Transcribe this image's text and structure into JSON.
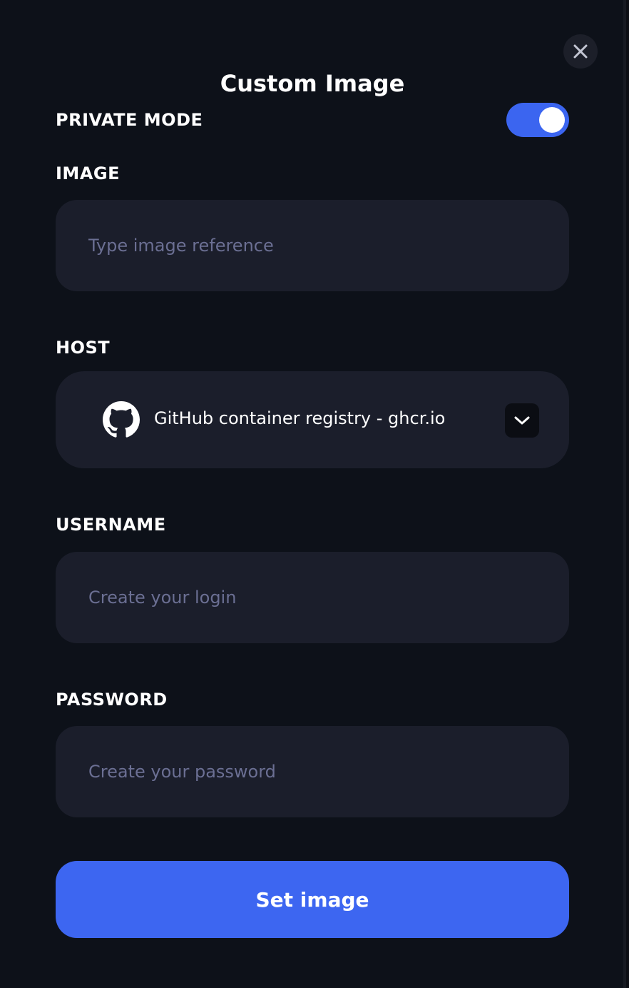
{
  "dialog": {
    "title": "Custom Image",
    "close_icon": "close-icon"
  },
  "private_mode": {
    "label": "PRIVATE MODE",
    "enabled": true
  },
  "image": {
    "label": "IMAGE",
    "value": "",
    "placeholder": "Type image reference"
  },
  "host": {
    "label": "HOST",
    "selected": "GitHub container registry - ghcr.io",
    "icon": "github-icon",
    "dropdown_icon": "chevron-down-icon"
  },
  "username": {
    "label": "USERNAME",
    "value": "",
    "placeholder": "Create your login"
  },
  "password": {
    "label": "PASSWORD",
    "value": "",
    "placeholder": "Create your password"
  },
  "submit": {
    "label": "Set image"
  },
  "colors": {
    "background": "#0d1119",
    "field": "#1b1e2b",
    "accent": "#3d66f1",
    "placeholder": "#6b6f93"
  }
}
